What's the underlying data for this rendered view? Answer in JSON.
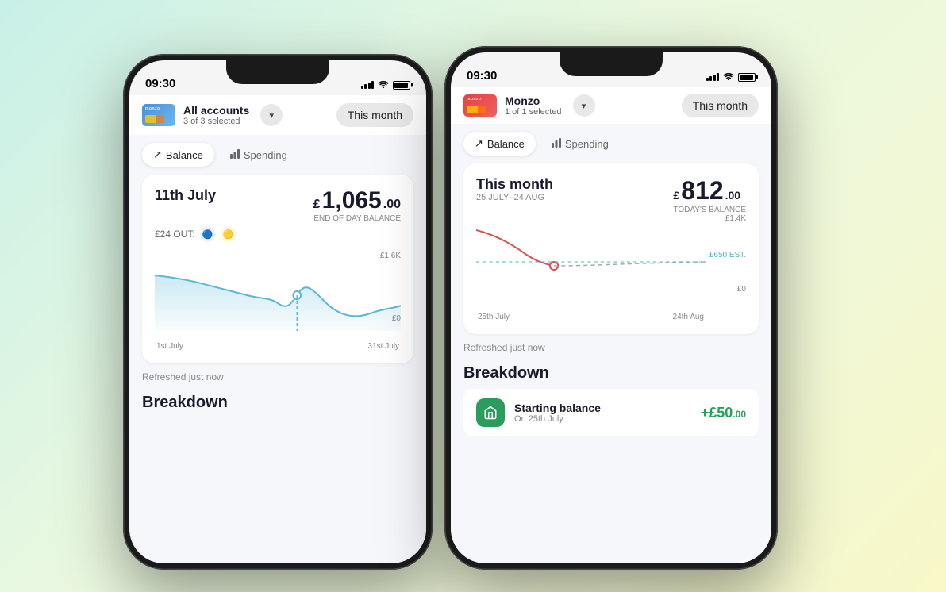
{
  "background": {
    "gradient": "linear-gradient(135deg, #c8f0e8, #e8f8e0, #f0f8d8, #f8f8c8)"
  },
  "phone_back": {
    "status": {
      "time": "09:30",
      "signal": 4,
      "wifi": true,
      "battery": 85
    },
    "account_selector": {
      "card_type": "blue",
      "account_name": "All accounts",
      "account_sub": "3 of 3 selected",
      "chevron": "▾",
      "time_filter": "This month"
    },
    "tabs": [
      {
        "label": "Balance",
        "icon": "↗",
        "active": true
      },
      {
        "label": "Spending",
        "icon": "▦",
        "active": false
      }
    ],
    "chart": {
      "date": "11th July",
      "amount_currency": "£",
      "amount_main": "1,065",
      "amount_dec": ".00",
      "amount_label": "END OF DAY BALANCE",
      "sub_text": "£24 OUT:",
      "y_label_top": "£1.6K",
      "y_label_bottom": "£0",
      "x_label_left": "1st July",
      "x_label_right": "31st July"
    },
    "refresh_text": "Refreshed just now",
    "breakdown_title": "Breakdown"
  },
  "phone_front": {
    "status": {
      "time": "09:30",
      "signal": 4,
      "wifi": true,
      "battery": 85
    },
    "account_selector": {
      "card_type": "red",
      "account_name": "Monzo",
      "account_sub": "1 of 1 selected",
      "chevron": "▾",
      "time_filter": "This month"
    },
    "tabs": [
      {
        "label": "Balance",
        "icon": "↗",
        "active": true
      },
      {
        "label": "Spending",
        "icon": "▦",
        "active": false
      }
    ],
    "chart": {
      "month_title": "This month",
      "date_range": "25 JULY–24 AUG",
      "amount_currency": "£",
      "amount_main": "812",
      "amount_dec": ".00",
      "amount_label": "TODAY'S BALANCE",
      "y_label_top": "£1.4K",
      "y_label_mid": "£650 EST.",
      "y_label_bottom": "£0",
      "x_label_left": "25th July",
      "x_label_right": "24th Aug"
    },
    "refresh_text": "Refreshed just now",
    "breakdown_title": "Breakdown",
    "breakdown_item": {
      "icon": "🏦",
      "name": "Starting balance",
      "date": "On 25th July",
      "amount_prefix": "+£",
      "amount_main": "50",
      "amount_dec": ".00"
    }
  }
}
